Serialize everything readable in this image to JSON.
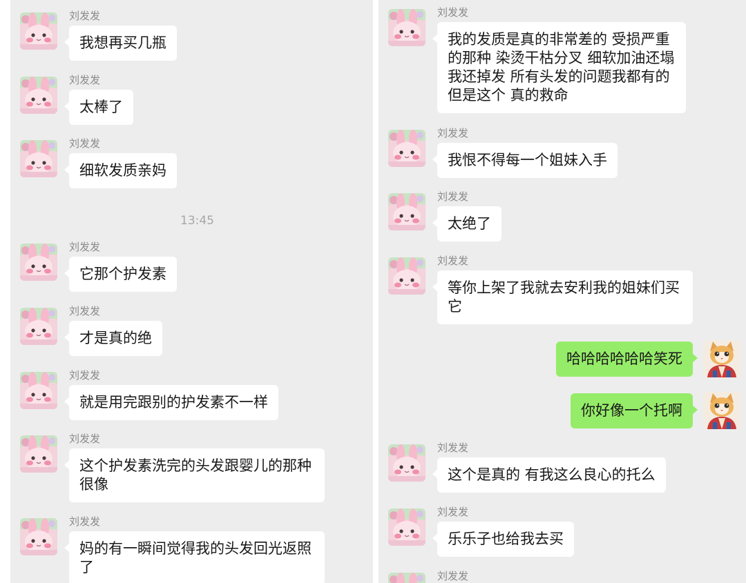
{
  "left_panel": {
    "timestamp": "13:45",
    "messages": [
      {
        "sender": "刘发发",
        "text": "我想再买几瓶"
      },
      {
        "sender": "刘发发",
        "text": "太棒了"
      },
      {
        "sender": "刘发发",
        "text": "细软发质亲妈"
      },
      {
        "sender": "刘发发",
        "text": "它那个护发素"
      },
      {
        "sender": "刘发发",
        "text": "才是真的绝"
      },
      {
        "sender": "刘发发",
        "text": "就是用完跟别的护发素不一样"
      },
      {
        "sender": "刘发发",
        "text": "这个护发素洗完的头发跟婴儿的那种很像"
      },
      {
        "sender": "刘发发",
        "text": "妈的有一瞬间觉得我的头发回光返照了"
      }
    ]
  },
  "right_panel": {
    "messages": [
      {
        "sender": "刘发发",
        "text": "我的发质是真的非常差的 受损严重的那种 染烫干枯分叉 细软加油还塌 我还掉发 所有头发的问题我都有的 但是这个 真的救命"
      },
      {
        "sender": "刘发发",
        "text": "我恨不得每一个姐妹入手"
      },
      {
        "sender": "刘发发",
        "text": "太绝了"
      },
      {
        "sender": "刘发发",
        "text": "等你上架了我就去安利我的姐妹们买它"
      },
      {
        "sender": "me",
        "text": "哈哈哈哈哈哈笑死"
      },
      {
        "sender": "me",
        "text": "你好像一个托啊"
      },
      {
        "sender": "刘发发",
        "text": "这个是真的 有我这么良心的托么"
      },
      {
        "sender": "刘发发",
        "text": "乐乐子也给我去买"
      },
      {
        "sender": "刘发发",
        "text": ""
      }
    ]
  },
  "colors": {
    "chat_bg": "#ededed",
    "bubble_other": "#ffffff",
    "bubble_me": "#95ec69",
    "name_text": "#8a8a8a",
    "timestamp_text": "#a7a7a7"
  },
  "icons": {
    "contact_avatar": "pink-bunny-avatar-icon",
    "my_avatar": "cartoon-cat-avatar-icon"
  }
}
